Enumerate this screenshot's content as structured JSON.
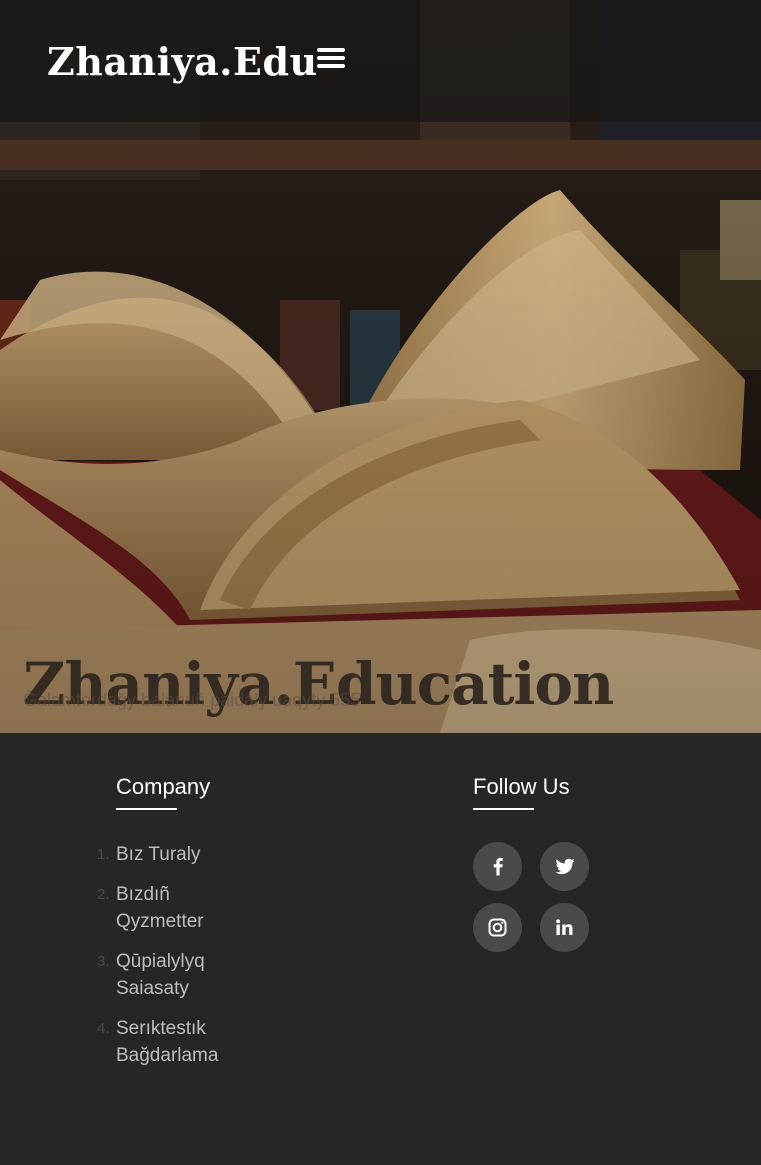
{
  "navbar": {
    "brand": "Zhaniya.Edu",
    "menu_icon": "hamburger-menu-icon"
  },
  "hero": {
    "title": "Zhaniya.Education",
    "subtitle": "Ğalamtordağy balanuñ paidaly uaqyty 555",
    "background_image": "open-books-photo"
  },
  "footer": {
    "company": {
      "heading": "Company",
      "links": [
        {
          "num": "1.",
          "label": "Bız Turaly"
        },
        {
          "num": "2.",
          "label": "Bızdıñ Qyzmetter"
        },
        {
          "num": "3.",
          "label": "Qūpialylyq Saiasaty"
        },
        {
          "num": "4.",
          "label": "Serıktestık Bağdarlama"
        }
      ]
    },
    "follow": {
      "heading": "Follow Us",
      "icons": [
        "facebook-icon",
        "twitter-icon",
        "instagram-icon",
        "linkedin-icon"
      ]
    }
  },
  "colors": {
    "footer_bg": "#262626",
    "social_bg": "#4a4a4a",
    "link": "#bdbdbd",
    "heading": "#ffffff"
  }
}
